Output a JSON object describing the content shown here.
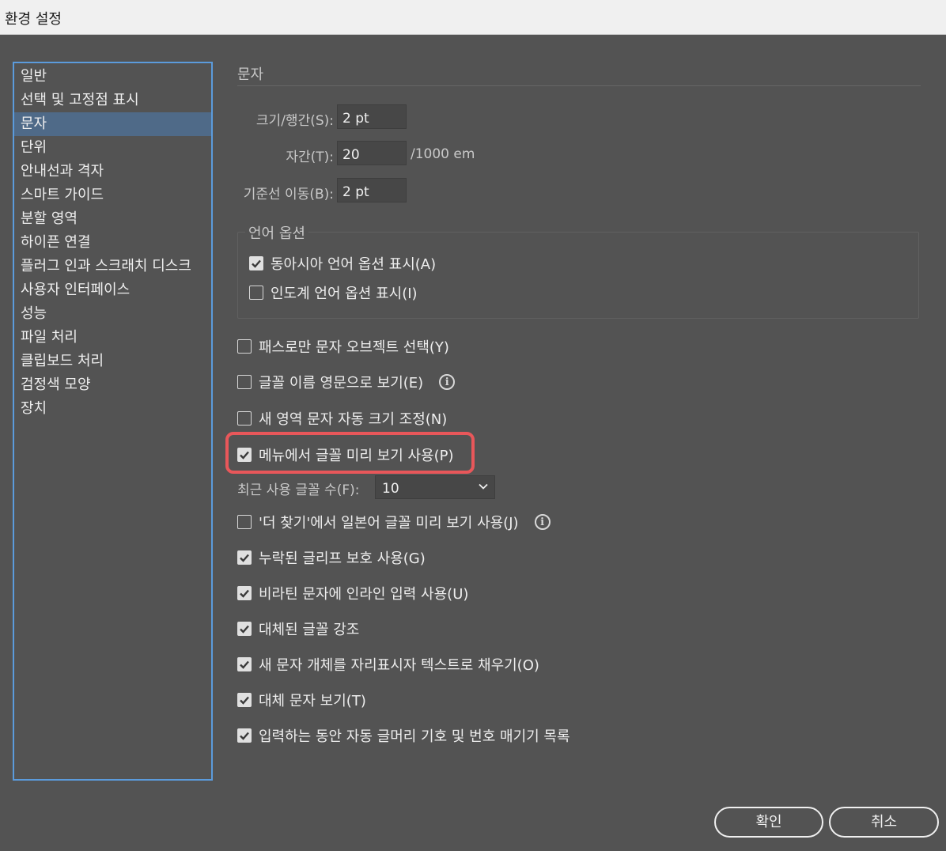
{
  "window": {
    "title": "환경 설정"
  },
  "sidebar": {
    "items": [
      {
        "label": "일반"
      },
      {
        "label": "선택 및 고정점 표시"
      },
      {
        "label": "문자",
        "active": true
      },
      {
        "label": "단위"
      },
      {
        "label": "안내선과 격자"
      },
      {
        "label": "스마트 가이드"
      },
      {
        "label": "분할 영역"
      },
      {
        "label": "하이픈 연결"
      },
      {
        "label": "플러그 인과 스크래치 디스크"
      },
      {
        "label": "사용자 인터페이스"
      },
      {
        "label": "성능"
      },
      {
        "label": "파일 처리"
      },
      {
        "label": "클립보드 처리"
      },
      {
        "label": "검정색 모양"
      },
      {
        "label": "장치"
      }
    ]
  },
  "panel": {
    "title": "문자",
    "size_leading": {
      "label": "크기/행간(S):",
      "value": "2 pt"
    },
    "tracking": {
      "label": "자간(T):",
      "value": "20",
      "unit": "/1000 em"
    },
    "baseline_shift": {
      "label": "기준선 이동(B):",
      "value": "2 pt"
    },
    "language_options": {
      "legend": "언어 옵션",
      "east_asian": {
        "label": "동아시아 언어 옵션 표시(A)",
        "checked": true
      },
      "indic": {
        "label": "인도계 언어 옵션 표시(I)",
        "checked": false
      }
    },
    "type_object_selection": {
      "label": "패스로만 문자 오브젝트 선택(Y)",
      "checked": false
    },
    "font_names_english": {
      "label": "글꼴 이름 영문으로 보기(E)",
      "checked": false
    },
    "auto_size_area": {
      "label": "새 영역 문자 자동 크기 조정(N)",
      "checked": false
    },
    "font_preview": {
      "label": "메뉴에서 글꼴 미리 보기 사용(P)",
      "checked": true
    },
    "recent_fonts": {
      "label": "최근 사용 글꼴 수(F):",
      "value": "10"
    },
    "japanese_preview": {
      "label": "'더 찾기'에서 일본어 글꼴 미리 보기 사용(J)",
      "checked": false
    },
    "missing_glyph": {
      "label": "누락된 글리프 보호 사용(G)",
      "checked": true
    },
    "inline_input": {
      "label": "비라틴 문자에 인라인 입력 사용(U)",
      "checked": true
    },
    "highlight_substituted": {
      "label": "대체된 글꼴 강조",
      "checked": true
    },
    "fill_placeholder": {
      "label": "새 문자 개체를 자리표시자 텍스트로 채우기(O)",
      "checked": true
    },
    "show_alternates": {
      "label": "대체 문자 보기(T)",
      "checked": true
    },
    "auto_bullets": {
      "label": "입력하는 동안 자동 글머리 기호 및 번호 매기기 목록",
      "checked": true
    }
  },
  "buttons": {
    "ok": "확인",
    "cancel": "취소"
  },
  "colors": {
    "accent": "#5b9bdc",
    "highlight": "#e8575a",
    "active_item": "#4f6a88",
    "background": "#535353"
  }
}
